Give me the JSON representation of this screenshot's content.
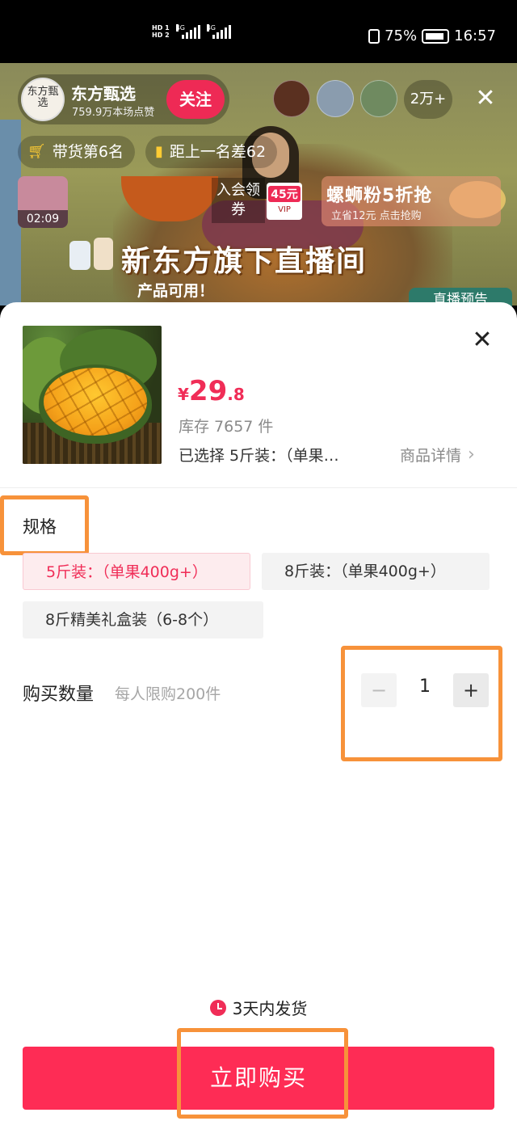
{
  "status_bar": {
    "left_tags": [
      "HD 1",
      "HD 2"
    ],
    "net1": "4G",
    "net2": "4G",
    "battery": "75%",
    "time": "16:57"
  },
  "live": {
    "anchor_name": "东方甄选",
    "anchor_avatar_text": "东方甄选",
    "likes": "759.9万本场点赞",
    "follow_label": "关注",
    "viewer_count": "2万+",
    "rank_label": "带货第6名",
    "gap_label": "距上一名差62",
    "replay_time": "02:09",
    "join_label": "入会领券",
    "vip_amount": "45元",
    "vip_tag": "VIP",
    "promo_title": "螺蛳粉5折抢",
    "promo_sub": "立省12元 点击抢购",
    "banner": "新东方旗下直播间",
    "subcaption": "产品可用！",
    "preview_tag": "直播预告"
  },
  "product": {
    "price_currency": "¥",
    "price_int": "29",
    "price_dec": ".8",
    "stock": "库存 7657 件",
    "selected": "已选择  5斤装：（单果…",
    "detail_link": "商品详情"
  },
  "spec": {
    "title": "规格",
    "options": [
      {
        "label": "5斤装：（单果400g+）",
        "selected": true
      },
      {
        "label": "8斤装：（单果400g+）",
        "selected": false
      },
      {
        "label": "8斤精美礼盒装（6-8个）",
        "selected": false
      }
    ]
  },
  "quantity": {
    "label": "购买数量",
    "limit": "每人限购200件",
    "minus": "−",
    "value": "1",
    "plus": "+"
  },
  "shipping": "3天内发货",
  "buy_label": "立即购买",
  "colors": {
    "accent": "#fe2c55",
    "price": "#f02d57",
    "highlight": "#f7923a"
  }
}
